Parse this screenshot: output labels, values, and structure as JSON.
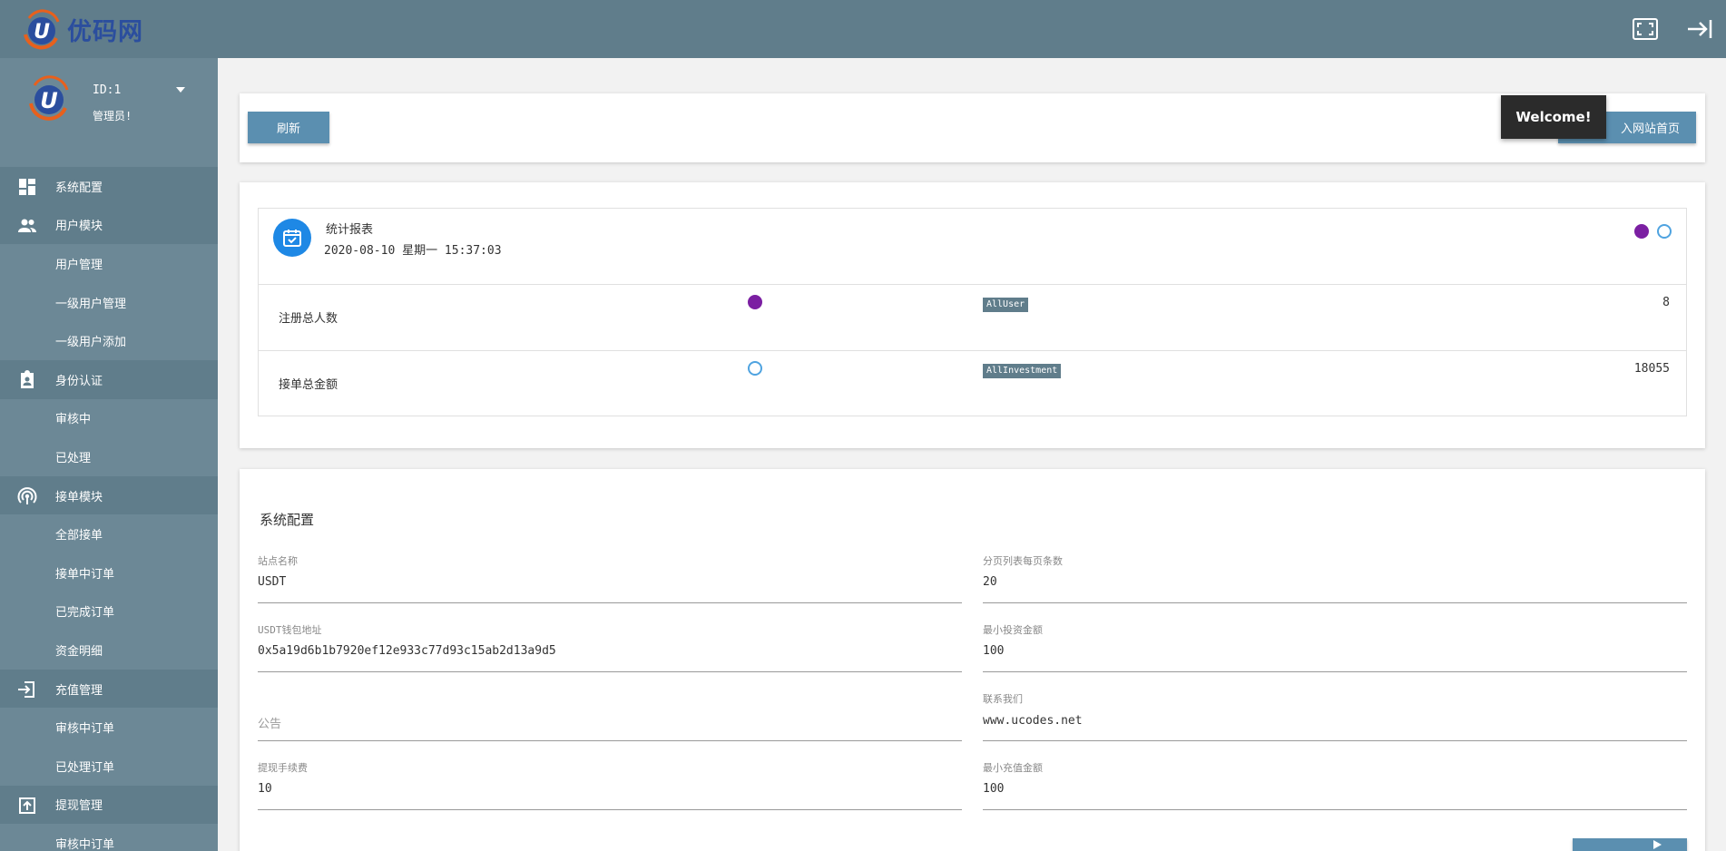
{
  "brand": {
    "name": "优码网"
  },
  "topbar": {
    "fullscreen_icon": "fullscreen-icon",
    "logout_icon": "logout-icon"
  },
  "profile": {
    "id": "ID:1",
    "role": "管理员!"
  },
  "sidebar": {
    "items": [
      {
        "label": "系统配置",
        "icon": "dashboard-icon",
        "type": "group"
      },
      {
        "label": "用户模块",
        "icon": "people-icon",
        "type": "group"
      },
      {
        "label": "用户管理",
        "type": "sub"
      },
      {
        "label": "一级用户管理",
        "type": "sub"
      },
      {
        "label": "一级用户添加",
        "type": "sub"
      },
      {
        "label": "身份认证",
        "icon": "id-badge-icon",
        "type": "group"
      },
      {
        "label": "审核中",
        "type": "sub"
      },
      {
        "label": "已处理",
        "type": "sub"
      },
      {
        "label": "接单模块",
        "icon": "broadcast-icon",
        "type": "group"
      },
      {
        "label": "全部接单",
        "type": "sub"
      },
      {
        "label": "接单中订单",
        "type": "sub"
      },
      {
        "label": "已完成订单",
        "type": "sub"
      },
      {
        "label": "资金明细",
        "type": "sub"
      },
      {
        "label": "充值管理",
        "icon": "login-icon",
        "type": "group"
      },
      {
        "label": "审核中订单",
        "type": "sub"
      },
      {
        "label": "已处理订单",
        "type": "sub"
      },
      {
        "label": "提现管理",
        "icon": "upload-box-icon",
        "type": "group"
      },
      {
        "label": "审核中订单",
        "type": "sub"
      }
    ]
  },
  "toolbar": {
    "refresh_label": "刷新",
    "home_label": "入网站首页"
  },
  "toast": {
    "text": "Welcome!"
  },
  "stats": {
    "title": "统计报表",
    "datetime": "2020-08-10  星期一 15:37:03",
    "rows": [
      {
        "label": "注册总人数",
        "tag": "AllUser",
        "value": "8"
      },
      {
        "label": "接单总金额",
        "tag": "AllInvestment",
        "value": "18055"
      }
    ]
  },
  "config": {
    "title": "系统配置",
    "fields": [
      {
        "label": "站点名称",
        "value": "USDT"
      },
      {
        "label": "分页列表每页条数",
        "value": "20"
      },
      {
        "label": "USDT钱包地址",
        "value": "0x5a19d6b1b7920ef12e933c77d93c15ab2d13a9d5"
      },
      {
        "label": "最小投资金额",
        "value": "100"
      },
      {
        "label": "",
        "placeholder": "公告",
        "value": ""
      },
      {
        "label": "联系我们",
        "value": "www.ucodes.net"
      },
      {
        "label": "提现手续费",
        "value": "10"
      },
      {
        "label": "最小充值金额",
        "value": "100"
      }
    ]
  },
  "colors": {
    "topbar": "#607d8b",
    "sidebar": "#6c8896",
    "button": "#5b8fb0",
    "accent": "#1e88e5"
  }
}
